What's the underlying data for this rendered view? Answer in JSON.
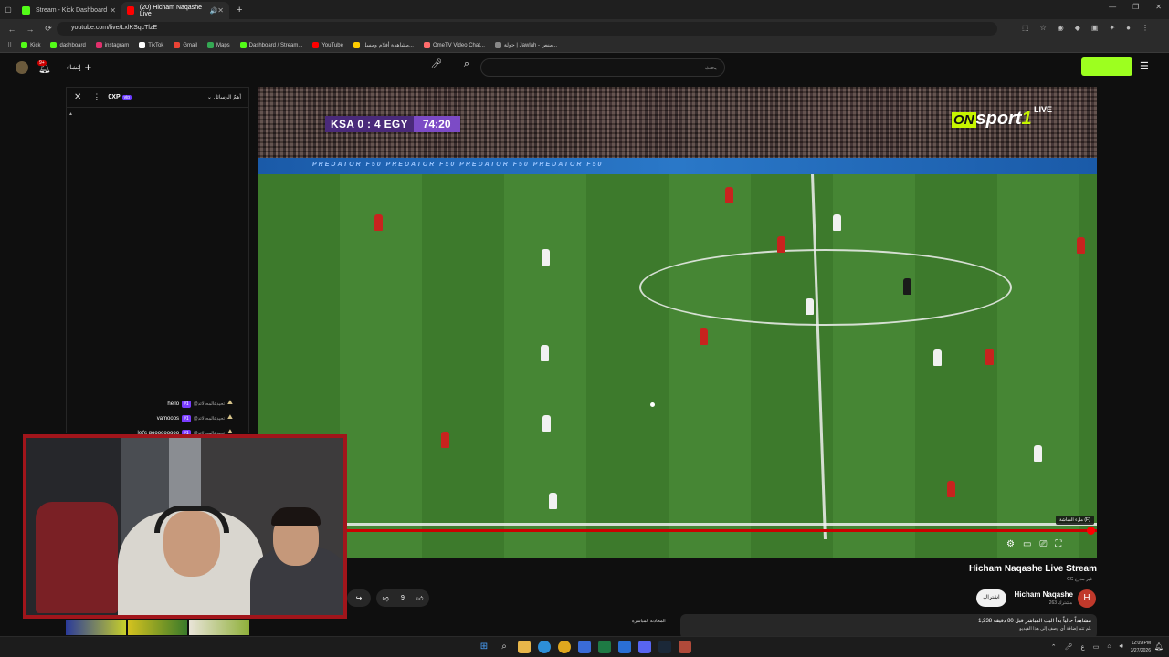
{
  "browser": {
    "tabs": [
      {
        "label": "Stream - Kick Dashboard",
        "color": "#53fc18",
        "active": false
      },
      {
        "label": "(20) Hicham Naqashe Live",
        "color": "#ff0000",
        "active": true
      }
    ],
    "new_tab": "+",
    "url": "youtube.com/live/LxlKSqcTlzE",
    "bookmarks": [
      {
        "label": "Kick",
        "color": "#53fc18"
      },
      {
        "label": "dashboard",
        "color": "#53fc18"
      },
      {
        "label": "instagram",
        "color": "#e1306c"
      },
      {
        "label": "TikTok",
        "color": "#ffffff"
      },
      {
        "label": "Gmail",
        "color": "#ea4335"
      },
      {
        "label": "Maps",
        "color": "#34a853"
      },
      {
        "label": "Dashboard / Stream...",
        "color": "#53fc18"
      },
      {
        "label": "YouTube",
        "color": "#ff0000"
      },
      {
        "label": "مشاهدة أفلام ومسل...",
        "color": "#ffcc00"
      },
      {
        "label": "OmeTV Video Chat...",
        "color": "#ff6b6b"
      },
      {
        "label": "جولة | Jawlah - منص...",
        "color": "#888888"
      }
    ]
  },
  "youtube": {
    "notif_badge": "9+",
    "create_label": "إنشاء",
    "search_placeholder": "بحث",
    "logo_color": "#9dff1f"
  },
  "chat": {
    "xp_label": "0XP",
    "xp_badge": "vip",
    "top_messages_label": "أهمّ الرسائل",
    "messages": [
      {
        "user": "@تحيدعالمحالائد",
        "rank": "#1",
        "text": "hello"
      },
      {
        "user": "@تحيدعالمحالائد",
        "rank": "#1",
        "text": "vamooos"
      },
      {
        "user": "@تحيدعالمحالائد",
        "rank": "#1",
        "text": "let's gooooooooo"
      }
    ]
  },
  "video": {
    "score": "KSA 0 : 4 EGY",
    "clock": "74:20",
    "broadcaster_on": "ON",
    "broadcaster_name": "sport",
    "broadcaster_num": "1",
    "live_label": "LIVE",
    "adboard_text": "PREDATOR  F50  PREDATOR  F50  PREDATOR  F50  PREDATOR  F50",
    "fullscreen_tooltip": "ملء الشاشة (F)",
    "progress_fraction": 1.0
  },
  "below_video": {
    "title": "Hicham Naqashe Live Stream",
    "sub": "CC غير مدرج",
    "channel_name": "Hicham Naqashe",
    "channel_initial": "H",
    "channel_subs": "263 مشترك",
    "subscribe_label": "اشتراك",
    "like_count": "9",
    "share_label": "مشاركة",
    "chat_sidebar_title": "المحادثة المباشرة",
    "desc_line1": "1,238 مشاهداً حالياً بدأ البث المباشر قبل 80 دقيقة",
    "desc_line2": "لم تتم إضافة أي وصف إلى هذا الفيديو."
  },
  "taskbar": {
    "time": "12:09 PM",
    "date": "3/27/2026",
    "lang": "ع"
  }
}
